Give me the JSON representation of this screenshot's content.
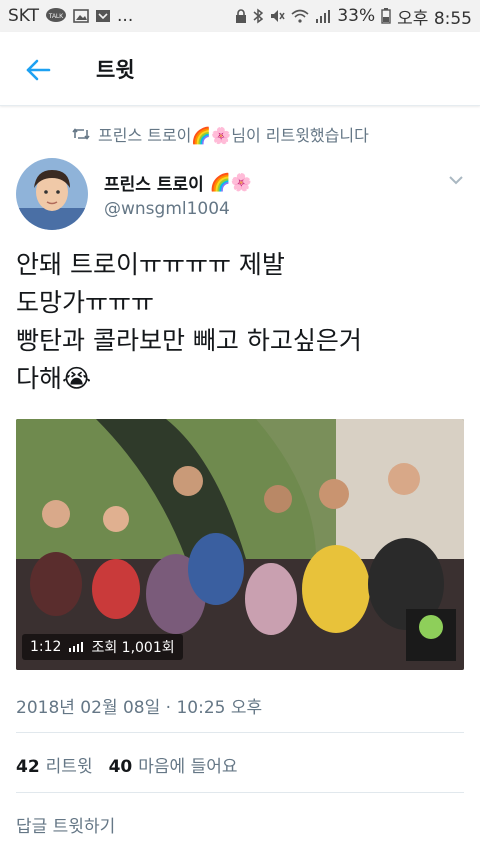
{
  "status_bar": {
    "carrier": "SKT",
    "talk_badge": "TALK",
    "ellipsis": "...",
    "battery": "33%",
    "time": "오후 8:55"
  },
  "header": {
    "title": "트윗"
  },
  "retweet_context": {
    "retweeter": "프린스 트로이🌈🌸",
    "suffix": " 님이 리트윗했습니다"
  },
  "tweet": {
    "author_name": "프린스 트로이",
    "author_emojis": "🌈🌸",
    "handle": "@wnsgml1004",
    "text": "안돼 트로이ㅠㅠㅠㅠ 제발\n도망가ㅠㅠㅠ\n빵탄과 콜라보만 빼고 하고싶은거\n다해😭",
    "video": {
      "duration": "1:12",
      "views": "조회 1,001회"
    },
    "timestamp": "2018년 02월 08일 · 10:25 오후",
    "retweets_count": "42",
    "retweets_label": "리트윗",
    "likes_count": "40",
    "likes_label": "마음에 들어요",
    "reply_label": "답글 트윗하기"
  },
  "colors": {
    "accent": "#1da1f2",
    "secondary_text": "#657786",
    "primary_text": "#14171a"
  }
}
